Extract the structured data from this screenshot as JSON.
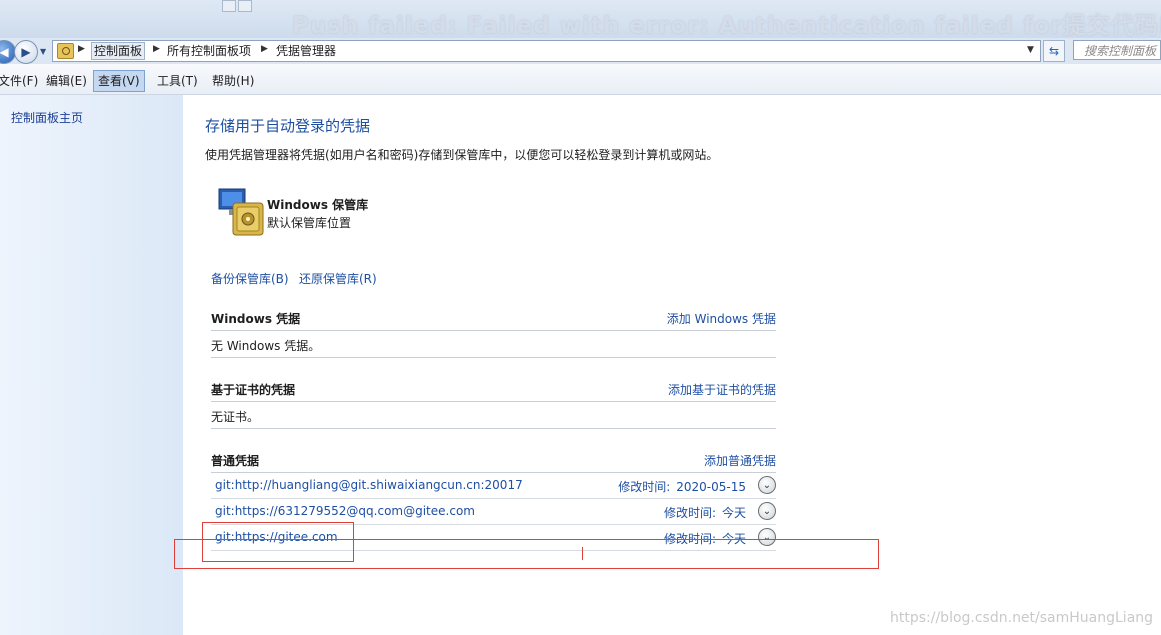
{
  "window": {
    "bg_title": "Push failed: Failed with error: Authentication failed for提交代码PU"
  },
  "address": {
    "crumbs": [
      "控制面板",
      "所有控制面板项",
      "凭据管理器"
    ],
    "search_placeholder": "搜索控制面板"
  },
  "menu": {
    "items": [
      "文件(F)",
      "编辑(E)",
      "查看(V)",
      "工具(T)",
      "帮助(H)"
    ],
    "active_index": 2
  },
  "sidebar": {
    "home_link": "控制面板主页"
  },
  "main": {
    "heading": "存储用于自动登录的凭据",
    "description": "使用凭据管理器将凭据(如用户名和密码)存储到保管库中，以便您可以轻松登录到计算机或网站。",
    "vault": {
      "title": "Windows 保管库",
      "subtitle": "默认保管库位置"
    },
    "backup_link": "备份保管库(B)",
    "restore_link": "还原保管库(R)",
    "windows_section": {
      "title": "Windows 凭据",
      "add": "添加 Windows 凭据",
      "empty": "无 Windows 凭据。"
    },
    "cert_section": {
      "title": "基于证书的凭据",
      "add": "添加基于证书的凭据",
      "empty": "无证书。"
    },
    "generic_section": {
      "title": "普通凭据",
      "add": "添加普通凭据",
      "modified_label": "修改时间:",
      "items": [
        {
          "name": "git:http://huangliang@git.shiwaixiangcun.cn:20017",
          "modified": "2020-05-15"
        },
        {
          "name": "git:https://631279552@qq.com@gitee.com",
          "modified": "今天"
        },
        {
          "name": "git:https://gitee.com",
          "modified": "今天"
        }
      ]
    }
  },
  "watermark": "https://blog.csdn.net/samHuangLiang",
  "colors": {
    "link": "#1e4fa3",
    "annotation": "#e0403a",
    "sidebar": "#e3edf9"
  }
}
